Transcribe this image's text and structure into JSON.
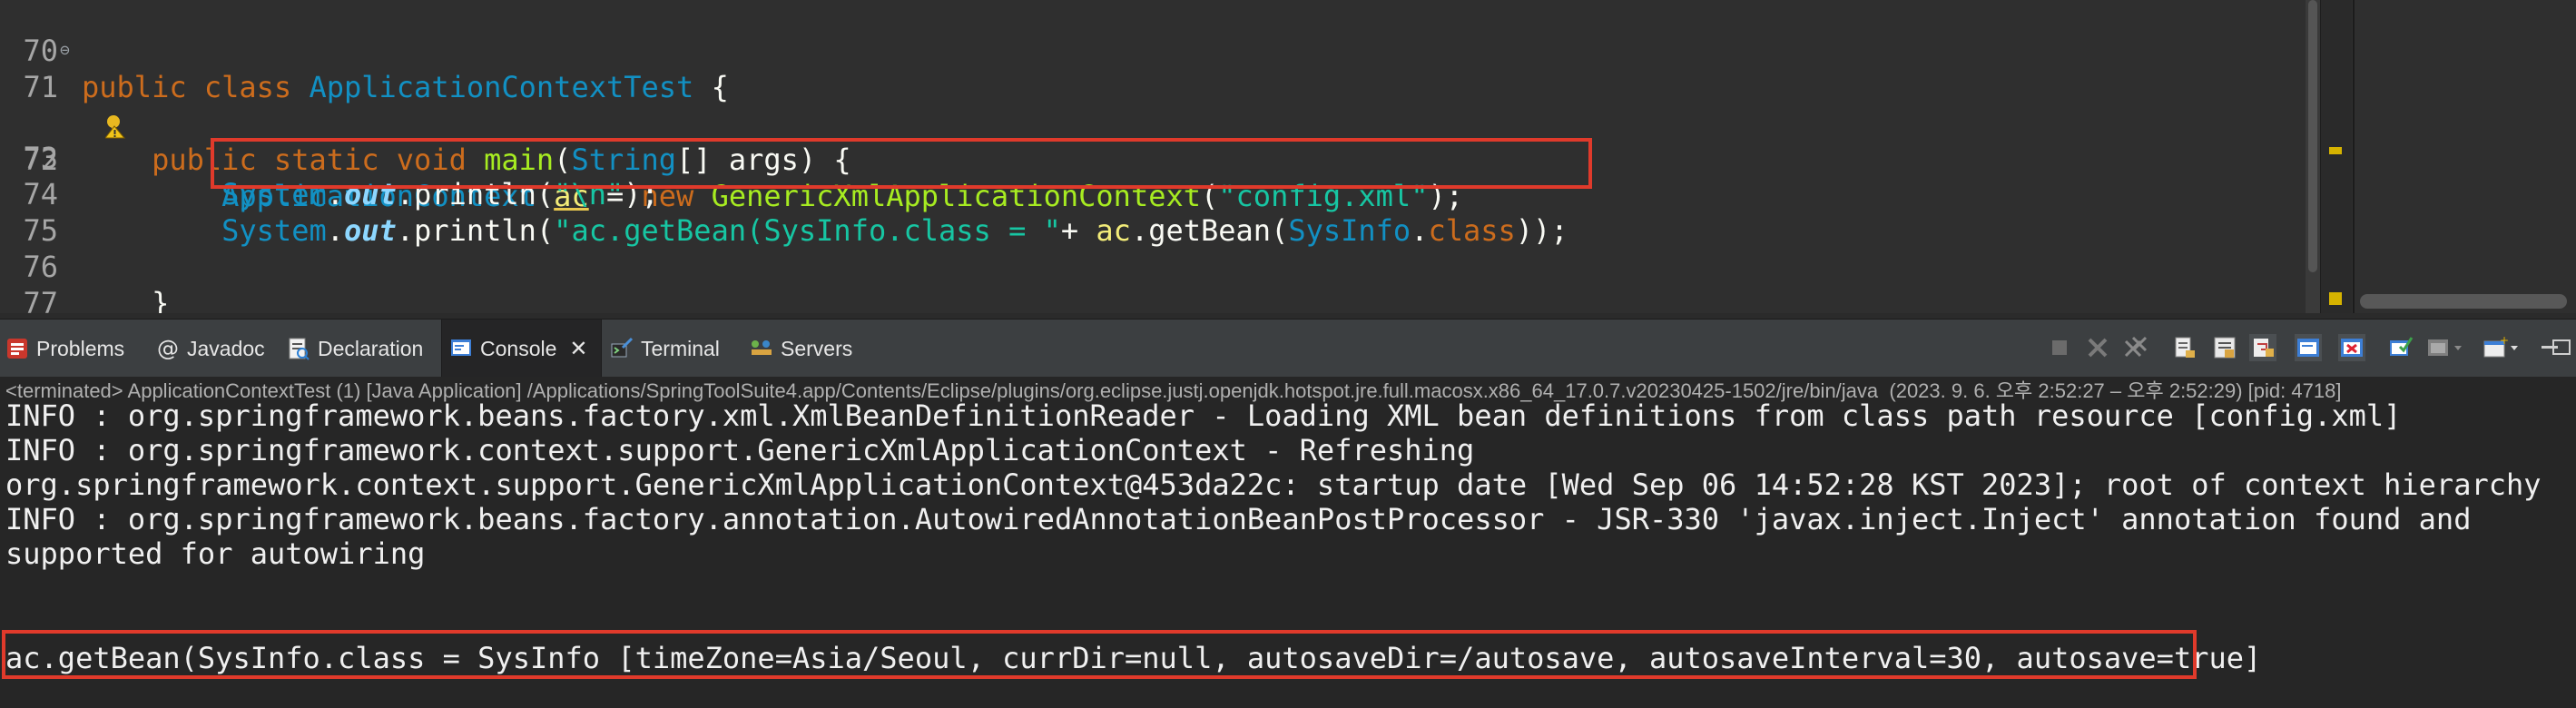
{
  "editor": {
    "lines": [
      {
        "num": "70",
        "tokens": [
          [
            "kw",
            "public "
          ],
          [
            "kw",
            "class "
          ],
          [
            "type",
            "ApplicationContextTest "
          ],
          [
            "plain",
            "{"
          ]
        ]
      },
      {
        "num": "71",
        "tokens": [
          [
            "plain",
            "    "
          ],
          [
            "kw",
            "public "
          ],
          [
            "kw",
            "static "
          ],
          [
            "kw",
            "void "
          ],
          [
            "fn",
            "main"
          ],
          [
            "plain",
            "("
          ],
          [
            "type",
            "String"
          ],
          [
            "plain",
            "[] "
          ],
          [
            "plain",
            "args) {"
          ]
        ]
      },
      {
        "num": "72",
        "tokens": [
          [
            "plain",
            "        "
          ],
          [
            "type",
            "ApplicationContext "
          ],
          [
            "var acu",
            "ac"
          ],
          [
            "plain",
            " = "
          ],
          [
            "kw",
            "new "
          ],
          [
            "fn",
            "GenericXmlApplicationContext"
          ],
          [
            "plain",
            "("
          ],
          [
            "str",
            "\"config.xml\""
          ],
          [
            "plain",
            ");"
          ]
        ]
      },
      {
        "num": "73",
        "tokens": [
          [
            "plain",
            "        "
          ],
          [
            "type",
            "System"
          ],
          [
            "plain",
            "."
          ],
          [
            "fld",
            "out"
          ],
          [
            "plain",
            "."
          ],
          [
            "plain",
            "println("
          ],
          [
            "str",
            "\"\\n\""
          ],
          [
            "plain",
            ");"
          ]
        ]
      },
      {
        "num": "74",
        "tokens": [
          [
            "plain",
            "        "
          ],
          [
            "type",
            "System"
          ],
          [
            "plain",
            "."
          ],
          [
            "fld",
            "out"
          ],
          [
            "plain",
            "."
          ],
          [
            "plain",
            "println("
          ],
          [
            "str",
            "\"ac.getBean(SysInfo.class = \""
          ],
          [
            "plain",
            "+ "
          ],
          [
            "var",
            "ac"
          ],
          [
            "plain",
            "."
          ],
          [
            "plain",
            "getBean("
          ],
          [
            "type",
            "SysInfo"
          ],
          [
            "plain",
            "."
          ],
          [
            "kw",
            "class"
          ],
          [
            "plain",
            "));"
          ]
        ]
      },
      {
        "num": "75",
        "tokens": []
      },
      {
        "num": "76",
        "tokens": [
          [
            "plain",
            "    }"
          ]
        ]
      },
      {
        "num": "77",
        "tokens": [
          [
            "plain",
            "}"
          ]
        ]
      }
    ]
  },
  "tabs": [
    {
      "label": "Problems",
      "icon": "problems-icon",
      "active": false
    },
    {
      "label": "Javadoc",
      "icon": "javadoc-icon",
      "active": false
    },
    {
      "label": "Declaration",
      "icon": "declaration-icon",
      "active": false
    },
    {
      "label": "Console",
      "icon": "console-icon",
      "active": true
    },
    {
      "label": "Terminal",
      "icon": "terminal-icon",
      "active": false
    },
    {
      "label": "Servers",
      "icon": "servers-icon",
      "active": false
    }
  ],
  "console": {
    "status": "<terminated> ApplicationContextTest (1) [Java Application] /Applications/SpringToolSuite4.app/Contents/Eclipse/plugins/org.eclipse.justj.openjdk.hotspot.jre.full.macosx.x86_64_17.0.7.v20230425-1502/jre/bin/java  (2023. 9. 6. 오후 2:52:27 – 오후 2:52:29) [pid: 4718]",
    "lines": [
      "INFO : org.springframework.beans.factory.xml.XmlBeanDefinitionReader - Loading XML bean definitions from class path resource [config.xml]",
      "INFO : org.springframework.context.support.GenericXmlApplicationContext - Refreshing",
      "org.springframework.context.support.GenericXmlApplicationContext@453da22c: startup date [Wed Sep 06 14:52:28 KST 2023]; root of context hierarchy",
      "INFO : org.springframework.beans.factory.annotation.AutowiredAnnotationBeanPostProcessor - JSR-330 'javax.inject.Inject' annotation found and",
      "supported for autowiring",
      "",
      "",
      "ac.getBean(SysInfo.class = SysInfo [timeZone=Asia/Seoul, currDir=null, autosaveDir=/autosave, autosaveInterval=30, autosave=true]"
    ]
  },
  "colors": {
    "highlight_box": "#e03a2b",
    "editor_bg": "#2f2f2f",
    "console_bg": "#262626"
  }
}
